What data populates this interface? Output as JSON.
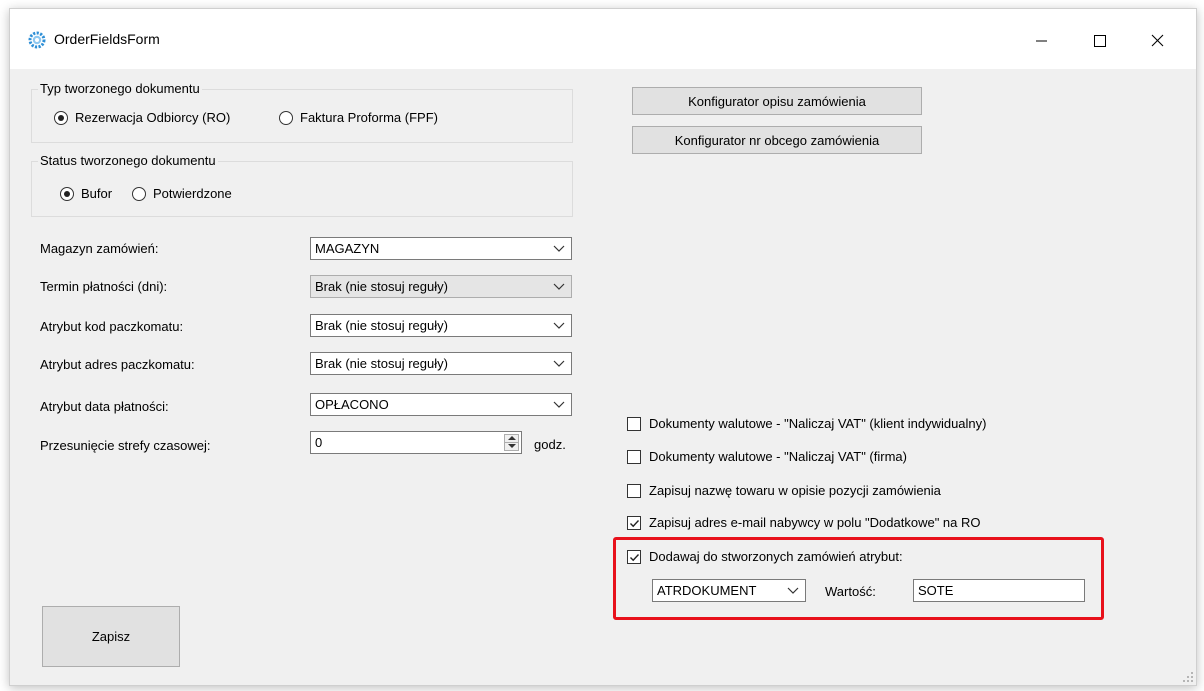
{
  "window": {
    "title": "OrderFieldsForm",
    "icon": "gear-app-icon"
  },
  "doc_type_group": {
    "title": "Typ tworzonego dokumentu",
    "options": [
      {
        "label": "Rezerwacja Odbiorcy (RO)",
        "selected": true
      },
      {
        "label": "Faktura Proforma (FPF)",
        "selected": false
      }
    ]
  },
  "doc_status_group": {
    "title": "Status tworzonego dokumentu",
    "options": [
      {
        "label": "Bufor",
        "selected": true
      },
      {
        "label": "Potwierdzone",
        "selected": false
      }
    ]
  },
  "fields": {
    "warehouse": {
      "label": "Magazyn zamówień:",
      "value": "MAGAZYN"
    },
    "payment_term": {
      "label": "Termin płatności (dni):",
      "value": "Brak (nie stosuj reguły)"
    },
    "locker_code": {
      "label": "Atrybut kod paczkomatu:",
      "value": "Brak (nie stosuj reguły)"
    },
    "locker_address": {
      "label": "Atrybut adres paczkomatu:",
      "value": "Brak (nie stosuj reguły)"
    },
    "payment_date": {
      "label": "Atrybut data płatności:",
      "value": "OPŁACONO"
    },
    "timezone_shift": {
      "label": "Przesunięcie strefy czasowej:",
      "value": "0",
      "unit": "godz."
    }
  },
  "buttons": {
    "description_config": "Konfigurator opisu zamówienia",
    "foreign_number_config": "Konfigurator nr obcego zamówienia",
    "save": "Zapisz"
  },
  "checkboxes": [
    {
      "label": "Dokumenty walutowe - \"Naliczaj VAT\" (klient indywidualny)",
      "checked": false
    },
    {
      "label": "Dokumenty walutowe - \"Naliczaj VAT\" (firma)",
      "checked": false
    },
    {
      "label": "Zapisuj nazwę towaru w opisie pozycji zamówienia",
      "checked": false
    },
    {
      "label": "Zapisuj adres e-mail nabywcy w polu \"Dodatkowe\" na RO",
      "checked": true
    },
    {
      "label": "Dodawaj do stworzonych zamówień atrybut:",
      "checked": true
    }
  ],
  "attribute": {
    "selected": "ATRDOKUMENT",
    "value_label": "Wartość:",
    "value": "SOTE"
  },
  "colors": {
    "highlight": "#e8111b",
    "window_bg": "#f0f0f0"
  }
}
